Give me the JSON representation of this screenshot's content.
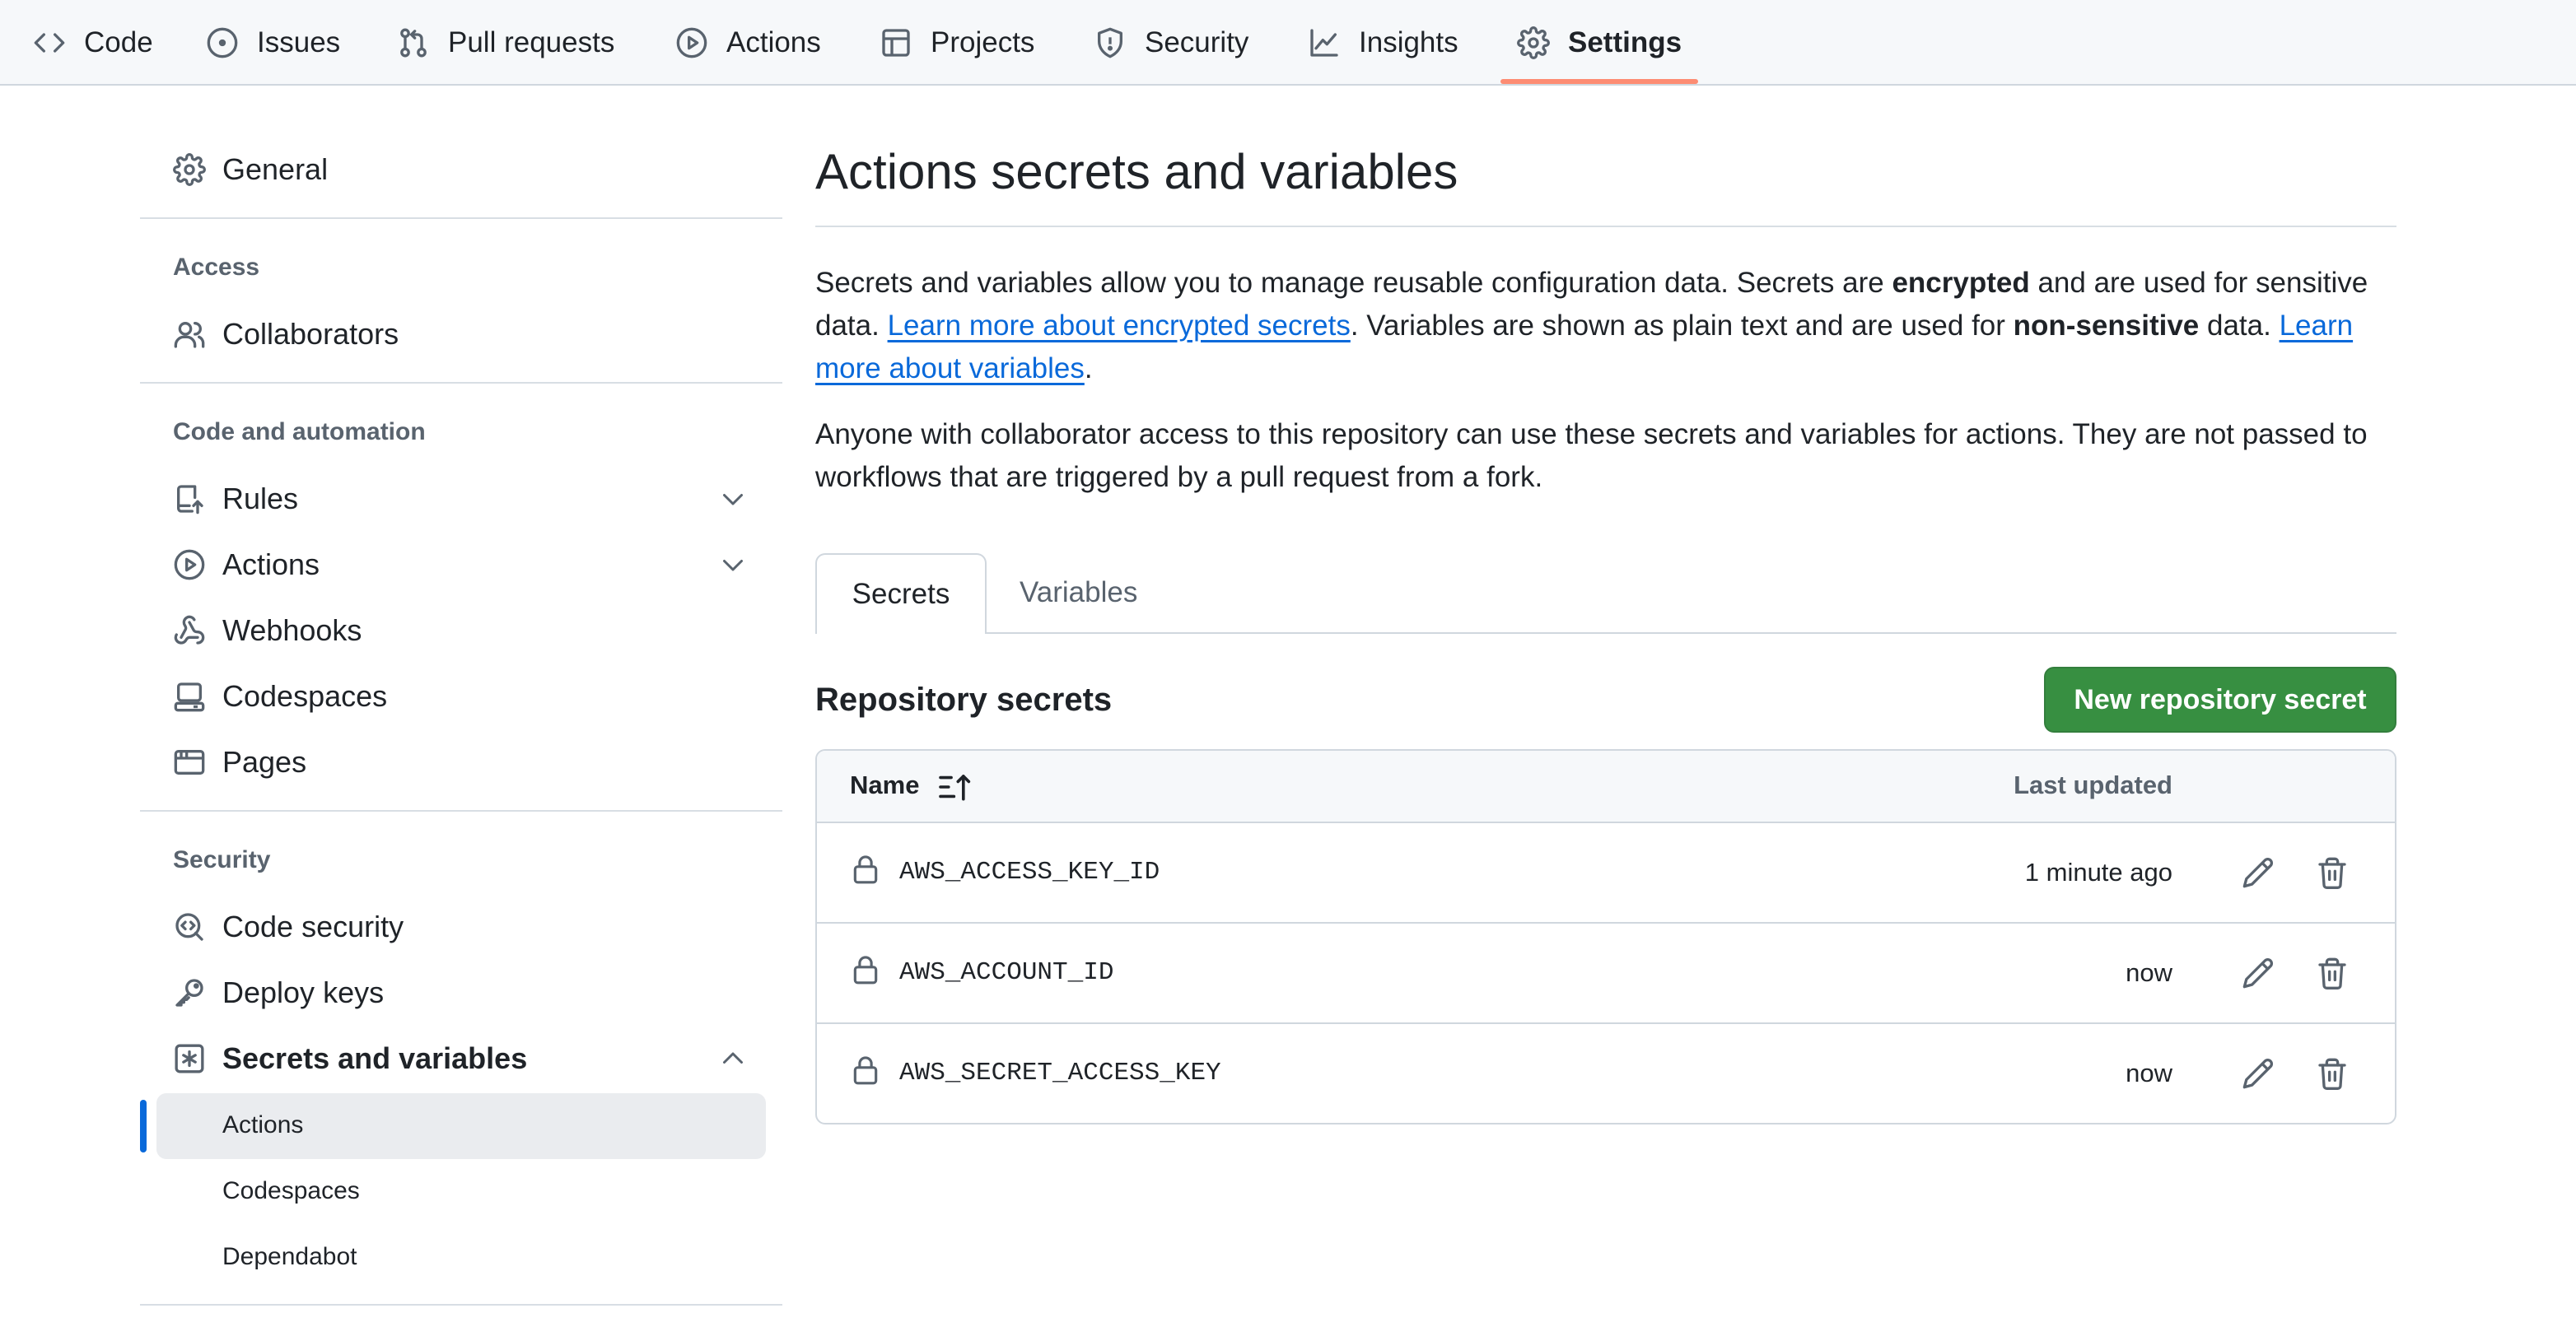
{
  "repo_nav": {
    "tabs": [
      {
        "label": "Code",
        "icon": "code-icon"
      },
      {
        "label": "Issues",
        "icon": "issue-opened-icon"
      },
      {
        "label": "Pull requests",
        "icon": "git-pull-request-icon"
      },
      {
        "label": "Actions",
        "icon": "play-icon"
      },
      {
        "label": "Projects",
        "icon": "table-icon"
      },
      {
        "label": "Security",
        "icon": "shield-icon"
      },
      {
        "label": "Insights",
        "icon": "graph-icon"
      },
      {
        "label": "Settings",
        "icon": "gear-icon",
        "selected": true
      }
    ]
  },
  "sidebar": {
    "general": "General",
    "access_heading": "Access",
    "collaborators": "Collaborators",
    "code_automation_heading": "Code and automation",
    "rules": "Rules",
    "actions": "Actions",
    "webhooks": "Webhooks",
    "codespaces": "Codespaces",
    "pages": "Pages",
    "security_heading": "Security",
    "code_security": "Code security",
    "deploy_keys": "Deploy keys",
    "secrets_and_variables": "Secrets and variables",
    "sub_items": {
      "actions": "Actions",
      "codespaces": "Codespaces",
      "dependabot": "Dependabot"
    }
  },
  "main": {
    "title": "Actions secrets and variables",
    "intro": {
      "p1_a": "Secrets and variables allow you to manage reusable configuration data. Secrets are ",
      "p1_b": "encrypted",
      "p1_c": " and are used for sensitive data. ",
      "link1": "Learn more about encrypted secrets",
      "p1_d": ". Variables are shown as plain text and are used for ",
      "p1_e": "non-sensitive",
      "p1_f": " data. ",
      "link2": "Learn more about variables",
      "p1_g": "."
    },
    "note": "Anyone with collaborator access to this repository can use these secrets and variables for actions. They are not passed to workflows that are triggered by a pull request from a fork.",
    "tabs": {
      "secrets": "Secrets",
      "variables": "Variables"
    },
    "section_title": "Repository secrets",
    "new_button": "New repository secret",
    "table": {
      "col_name": "Name",
      "col_updated": "Last updated",
      "rows": [
        {
          "name": "AWS_ACCESS_KEY_ID",
          "updated": "1 minute ago"
        },
        {
          "name": "AWS_ACCOUNT_ID",
          "updated": "now"
        },
        {
          "name": "AWS_SECRET_ACCESS_KEY",
          "updated": "now"
        }
      ]
    }
  },
  "colors": {
    "accent_underline": "#fd8c73",
    "link": "#0969da",
    "primary_button": "#378f41",
    "active_indicator": "#0969da"
  }
}
